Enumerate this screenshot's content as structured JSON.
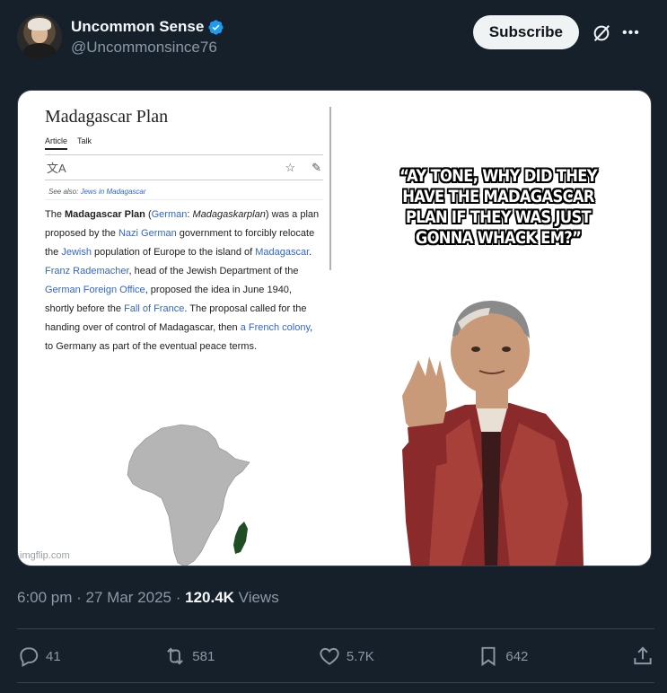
{
  "author": {
    "display_name": "Uncommon Sense",
    "handle": "@Uncommonsince76",
    "verified": true
  },
  "header": {
    "subscribe_label": "Subscribe",
    "more_label": "•••"
  },
  "media": {
    "wiki": {
      "title": "Madagascar Plan",
      "tabs": [
        "Article",
        "Talk"
      ],
      "see_also_prefix": "See also: ",
      "see_also_link": "Jews in Madagascar",
      "body_parts": [
        {
          "t": "The ",
          "style": "text"
        },
        {
          "t": "Madagascar Plan",
          "style": "bold"
        },
        {
          "t": " (",
          "style": "text"
        },
        {
          "t": "German",
          "style": "link"
        },
        {
          "t": ": ",
          "style": "text"
        },
        {
          "t": "Madagaskarplan",
          "style": "italic"
        },
        {
          "t": ") was a plan proposed by the ",
          "style": "text"
        },
        {
          "t": "Nazi German",
          "style": "link"
        },
        {
          "t": " government to forcibly relocate the ",
          "style": "text"
        },
        {
          "t": "Jewish",
          "style": "link"
        },
        {
          "t": " population of Europe to the island of ",
          "style": "text"
        },
        {
          "t": "Madagascar",
          "style": "link"
        },
        {
          "t": ". ",
          "style": "text"
        },
        {
          "t": "Franz Rademacher",
          "style": "link"
        },
        {
          "t": ", head of the Jewish Department of the ",
          "style": "text"
        },
        {
          "t": "German Foreign Office",
          "style": "link"
        },
        {
          "t": ", proposed the idea in June 1940, shortly before the ",
          "style": "text"
        },
        {
          "t": "Fall of France",
          "style": "link"
        },
        {
          "t": ". The proposal called for the handing over of control of Madagascar, then ",
          "style": "text"
        },
        {
          "t": "a French colony",
          "style": "link"
        },
        {
          "t": ", to Germany as part of the eventual peace terms.",
          "style": "text"
        }
      ]
    },
    "watermark": "imgflip.com",
    "meme_caption": "“AY TONE, WHY DID THEY HAVE THE MADAGASCAR PLAN IF THEY WAS JUST GONNA WHACK EM?”"
  },
  "meta": {
    "time": "6:00 pm",
    "date": "27 Mar 2025",
    "views_count": "120.4K",
    "views_label": "Views"
  },
  "actions": {
    "replies": "41",
    "reposts": "581",
    "likes": "5.7K",
    "bookmarks": "642"
  },
  "colors": {
    "background": "#15202b",
    "verified": "#1d9bf0",
    "link": "#3366cc",
    "muted": "#8b98a5"
  }
}
